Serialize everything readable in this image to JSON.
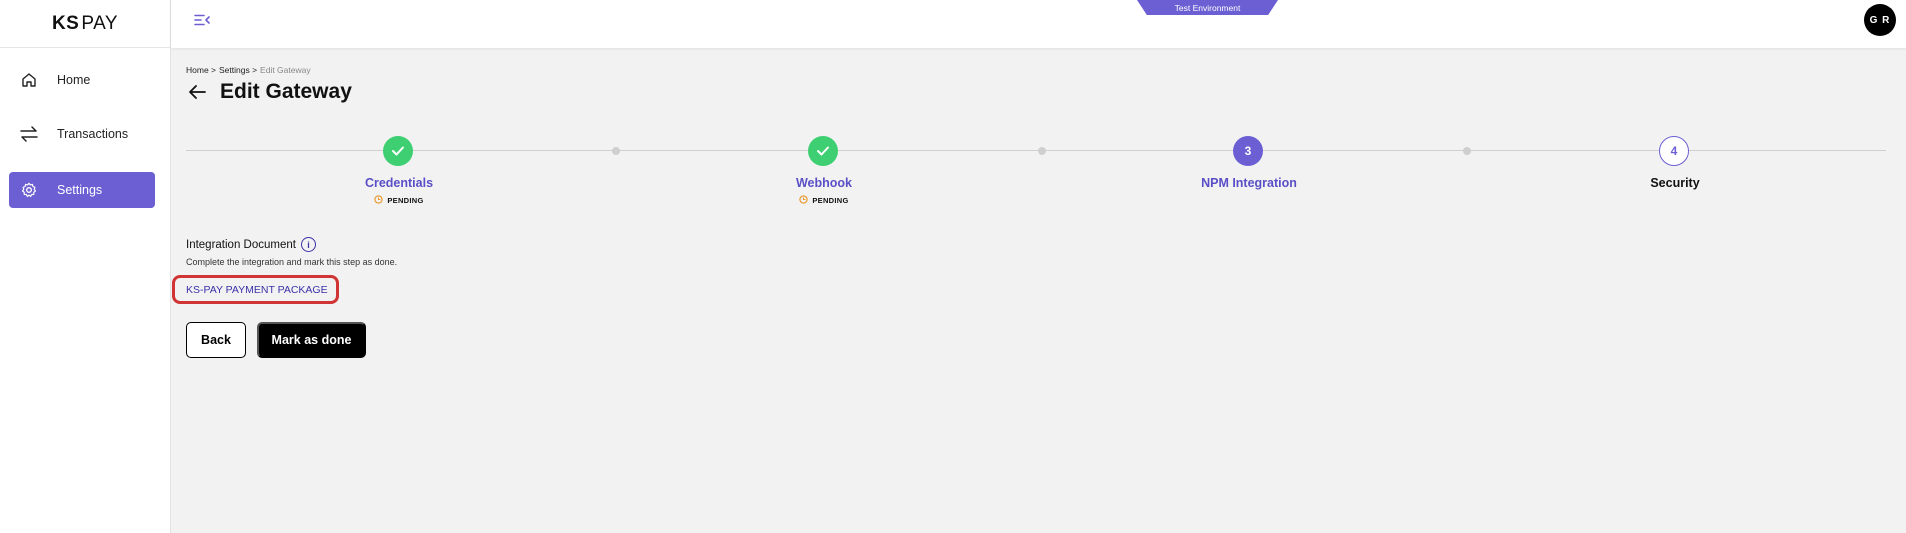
{
  "app": {
    "logo_bold": "KS",
    "logo_light": "PAY"
  },
  "sidebar": {
    "items": [
      {
        "label": "Home",
        "icon": "home-icon",
        "active": false
      },
      {
        "label": "Transactions",
        "icon": "transfer-arrows-icon",
        "active": false
      },
      {
        "label": "Settings",
        "icon": "gear-icon",
        "active": true
      }
    ]
  },
  "topbar": {
    "environment": "Test Environment",
    "avatar_initials": "G R"
  },
  "breadcrumb": {
    "home": "Home >",
    "settings": "Settings >",
    "current": "Edit Gateway"
  },
  "page": {
    "title": "Edit Gateway"
  },
  "stepper": {
    "steps": [
      {
        "label": "Credentials",
        "state": "done",
        "status": "PENDING"
      },
      {
        "label": "Webhook",
        "state": "done",
        "status": "PENDING"
      },
      {
        "label": "NPM Integration",
        "state": "current",
        "number": "3"
      },
      {
        "label": "Security",
        "state": "future",
        "number": "4"
      }
    ]
  },
  "content": {
    "doc_title": "Integration Document",
    "doc_description": "Complete the integration and mark this step as done.",
    "package_link": "KS-PAY PAYMENT PACKAGE"
  },
  "actions": {
    "back_label": "Back",
    "done_label": "Mark as done"
  },
  "colors": {
    "accent": "#6b5fd3",
    "success": "#3ecf72",
    "highlight": "#d13434",
    "pending": "#e89a2c"
  }
}
